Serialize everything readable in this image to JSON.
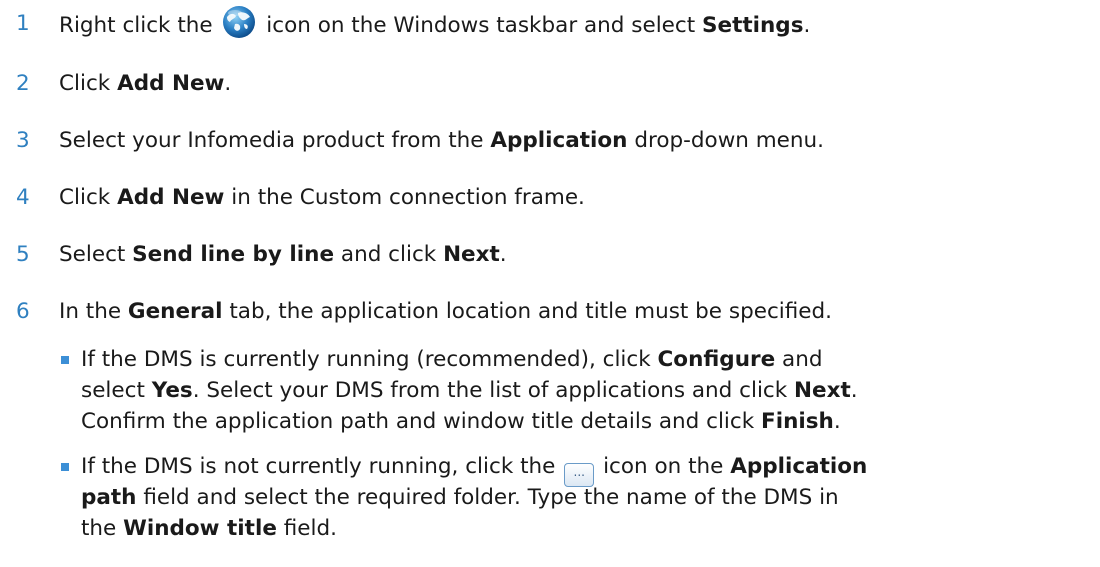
{
  "steps": [
    {
      "num": "1",
      "a": "Right click the ",
      "b": " icon on the Windows taskbar and select ",
      "bold1": "Settings",
      "c": "."
    },
    {
      "num": "2",
      "a": "Click ",
      "bold1": "Add New",
      "b": "."
    },
    {
      "num": "3",
      "a": "Select your Infomedia product from the ",
      "bold1": "Application",
      "b": " drop-down menu."
    },
    {
      "num": "4",
      "a": "Click ",
      "bold1": "Add New",
      "b": " in the Custom connection frame."
    },
    {
      "num": "5",
      "a": "Select ",
      "bold1": "Send line by line",
      "b": " and click ",
      "bold2": "Next",
      "c": "."
    },
    {
      "num": "6",
      "a": "In the ",
      "bold1": "General",
      "b": " tab, the application location and title must be specified."
    }
  ],
  "bullets": [
    {
      "l1a": "If the DMS is currently running (recommended), click ",
      "l1b": "Configure",
      "l1c": " and",
      "l2a": "select ",
      "l2b": "Yes",
      "l2c": ". Select your DMS from the list of applications and click ",
      "l2d": "Next",
      "l2e": ".",
      "l3a": "Confirm the application path and window title details and click ",
      "l3b": "Finish",
      "l3c": "."
    },
    {
      "l1a": "If the DMS is not currently running, click the ",
      "icon_text": "...",
      "l1b": " icon on the ",
      "l1c": "Application",
      "l2a": "path",
      "l2b": " field and select the required folder. Type the name of the DMS in",
      "l3a": "the ",
      "l3b": "Window title",
      "l3c": " field."
    }
  ],
  "icons": {
    "taskbar": "globe-icon",
    "browse": "ellipsis-browse-icon"
  },
  "colors": {
    "step_number": "#2f80c0",
    "bullet": "#3c8fd6",
    "text": "#1a1a1a"
  }
}
